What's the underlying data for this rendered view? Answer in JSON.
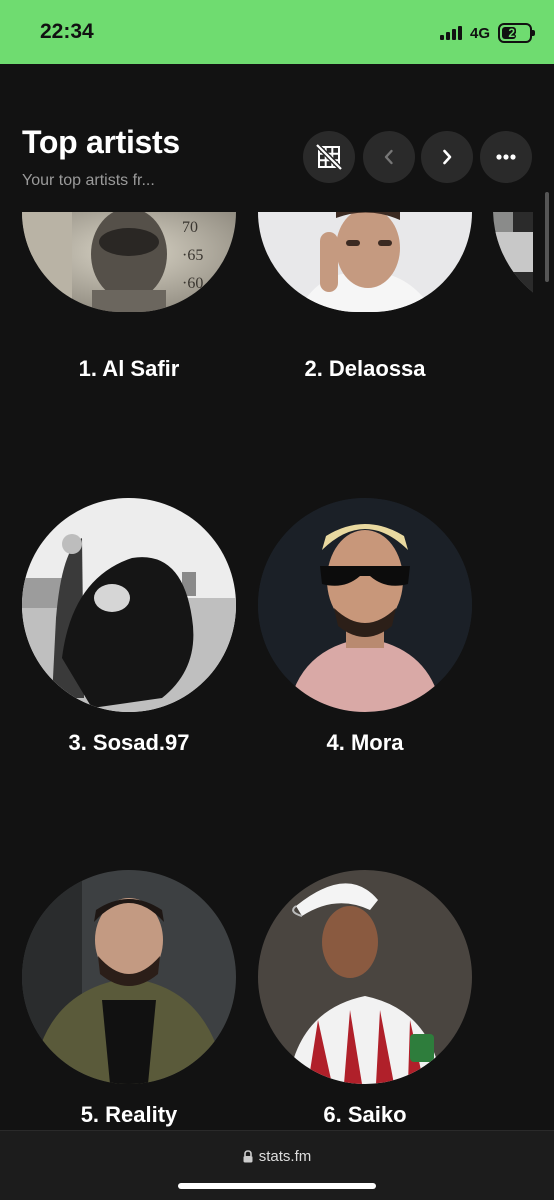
{
  "status_bar": {
    "time": "22:34",
    "network": "4G",
    "battery": "24",
    "battery_level": 0.24
  },
  "header": {
    "title": "Top artists",
    "subtitle": "Your top artists fr..."
  },
  "artists": [
    {
      "name": "1. Al Safir"
    },
    {
      "name": "2. Delaossa"
    },
    {
      "name": "3. Sosad.97"
    },
    {
      "name": "4. Mora"
    },
    {
      "name": "5. Reality"
    },
    {
      "name": "6. Saiko"
    }
  ],
  "browser": {
    "url": "stats.fm"
  }
}
